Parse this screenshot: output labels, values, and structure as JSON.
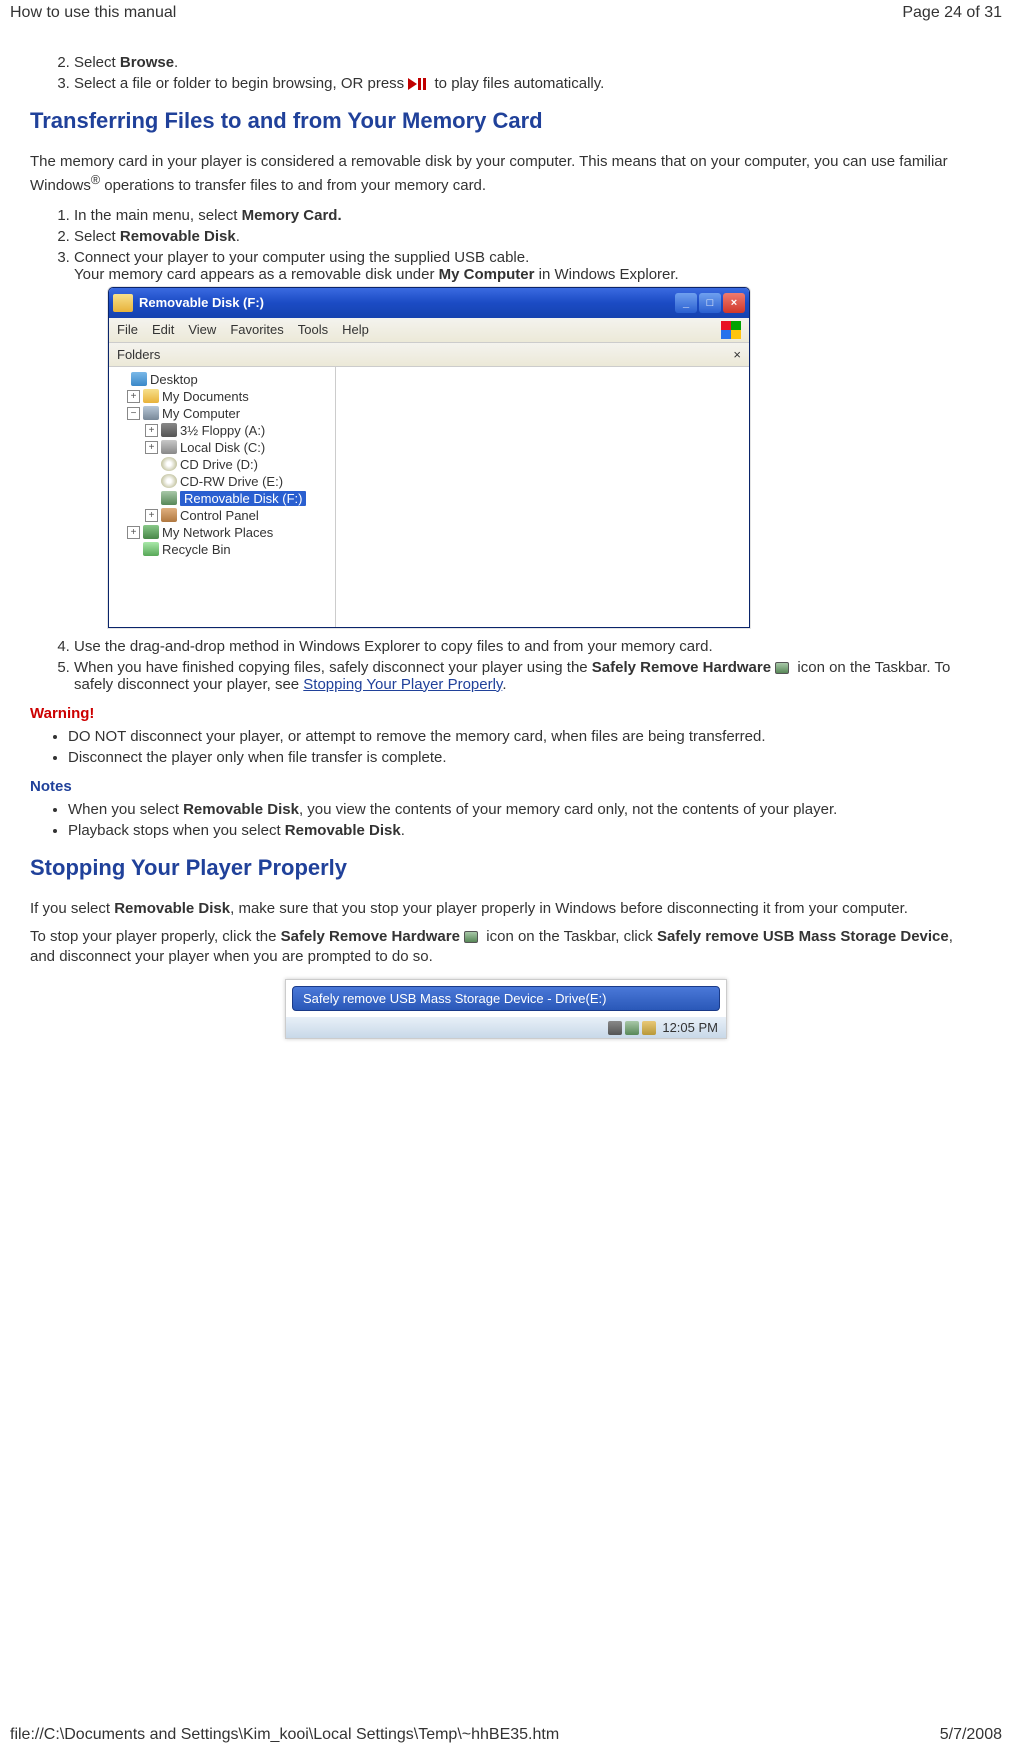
{
  "header": {
    "title": "How to use this manual",
    "page_indicator": "Page 24 of 31"
  },
  "section1": {
    "step2_prefix": "Select ",
    "step2_bold": "Browse",
    "step2_suffix": ".",
    "step3_prefix": "Select a file or folder to begin browsing, OR press ",
    "step3_suffix": " to play files automatically."
  },
  "heading_transfer": "Transferring Files to and from Your Memory Card",
  "transfer_intro_a": "The memory card in your player is considered a removable disk by your computer. This means that on your computer, you can use familiar Windows",
  "transfer_intro_sup": "®",
  "transfer_intro_b": " operations to transfer files to and from your memory card.",
  "transfer_steps": {
    "s1_a": "In the main menu, select ",
    "s1_b": "Memory Card.",
    "s2_a": "Select ",
    "s2_b": "Removable Disk",
    "s2_c": ".",
    "s3_a": "Connect your player to your computer using the supplied USB cable.",
    "s3_b_prefix": "Your memory card appears as a removable disk under ",
    "s3_b_bold": "My Computer",
    "s3_b_suffix": " in Windows Explorer.",
    "s4": "Use the drag-and-drop method in Windows Explorer to copy files to and from your memory card.",
    "s5_a": "When you have finished copying files, safely disconnect your player using the ",
    "s5_b": "Safely Remove Hardware",
    "s5_c": " icon on the Taskbar. To safely disconnect your player, see ",
    "s5_link": "Stopping Your Player Properly",
    "s5_d": "."
  },
  "explorer": {
    "title": "Removable Disk (F:)",
    "menu": [
      "File",
      "Edit",
      "View",
      "Favorites",
      "Tools",
      "Help"
    ],
    "folders_label": "Folders",
    "tree": {
      "desktop": "Desktop",
      "mydocs": "My Documents",
      "mycomputer": "My Computer",
      "floppy": "3½ Floppy (A:)",
      "localdisk": "Local Disk (C:)",
      "cddrive": "CD Drive (D:)",
      "cdrw": "CD-RW Drive (E:)",
      "removable": "Removable Disk (F:)",
      "cpanel": "Control Panel",
      "network": "My Network Places",
      "recycle": "Recycle Bin"
    }
  },
  "warning_title": "Warning!",
  "warnings": [
    "DO NOT disconnect your player, or attempt to remove the memory card, when files are being transferred.",
    "Disconnect the player only when file transfer is complete."
  ],
  "notes_title": "Notes",
  "notes": {
    "n1_a": "When you select ",
    "n1_b": "Removable Disk",
    "n1_c": ", you view the contents of your memory card only, not the contents of your player.",
    "n2_a": "Playback stops when you select ",
    "n2_b": "Removable Disk",
    "n2_c": "."
  },
  "heading_stopping": "Stopping Your Player Properly",
  "stopping_p1_a": "If you select ",
  "stopping_p1_b": "Removable Disk",
  "stopping_p1_c": ", make sure that you stop your player properly in Windows before disconnecting it from your computer.",
  "stopping_p2_a": "To stop your player properly, click the ",
  "stopping_p2_b": "Safely Remove Hardware",
  "stopping_p2_c": " icon on the Taskbar, click ",
  "stopping_p2_d": "Safely remove USB Mass Storage Device",
  "stopping_p2_e": ", and disconnect your player when you are prompted to do so.",
  "tray": {
    "balloon": "Safely remove USB Mass Storage Device - Drive(E:)",
    "time": "12:05 PM"
  },
  "footer": {
    "path": "file://C:\\Documents and Settings\\Kim_kooi\\Local Settings\\Temp\\~hhBE35.htm",
    "date": "5/7/2008"
  }
}
